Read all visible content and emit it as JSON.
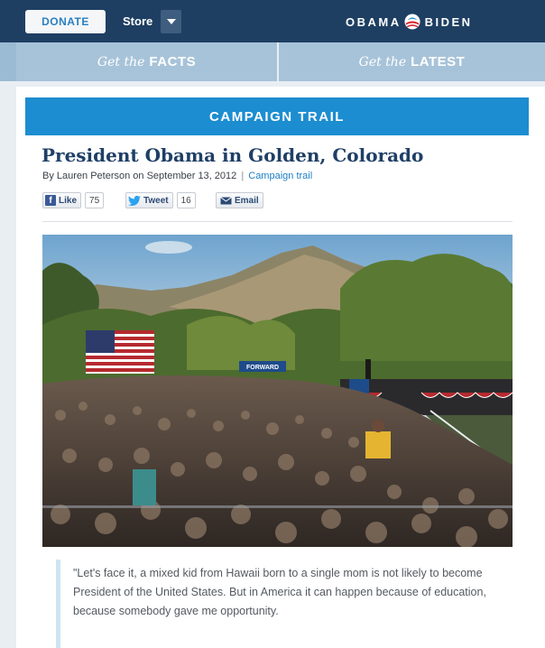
{
  "header": {
    "donate_label": "DONATE",
    "store_label": "Store",
    "logo_left": "OBAMA",
    "logo_right": "BIDEN"
  },
  "subnav": {
    "facts_prefix": "Get the",
    "facts_label": "FACTS",
    "latest_prefix": "Get the",
    "latest_label": "LATEST"
  },
  "article": {
    "section": "CAMPAIGN TRAIL",
    "title": "President Obama in Golden, Colorado",
    "byline": "By Lauren Peterson on September 13, 2012",
    "separator": "|",
    "category": "Campaign trail",
    "quote": "\"Let's face it, a mixed kid from Hawaii born to a single mom is not likely to become President of the United States. But in America it can happen because of education, because somebody gave me opportunity."
  },
  "social": {
    "like_label": "Like",
    "like_count": "75",
    "tweet_label": "Tweet",
    "tweet_count": "16",
    "email_label": "Email"
  },
  "photo": {
    "banner_text": "FORWARD"
  },
  "colors": {
    "header_bg": "#1e3f62",
    "accent_blue": "#1c8dd1",
    "subnav_bg": "#a7c3d9",
    "headline": "#1f3f66"
  },
  "icons": [
    "chevron-down-icon",
    "obama-logo-icon",
    "facebook-icon",
    "twitter-icon",
    "email-icon"
  ]
}
